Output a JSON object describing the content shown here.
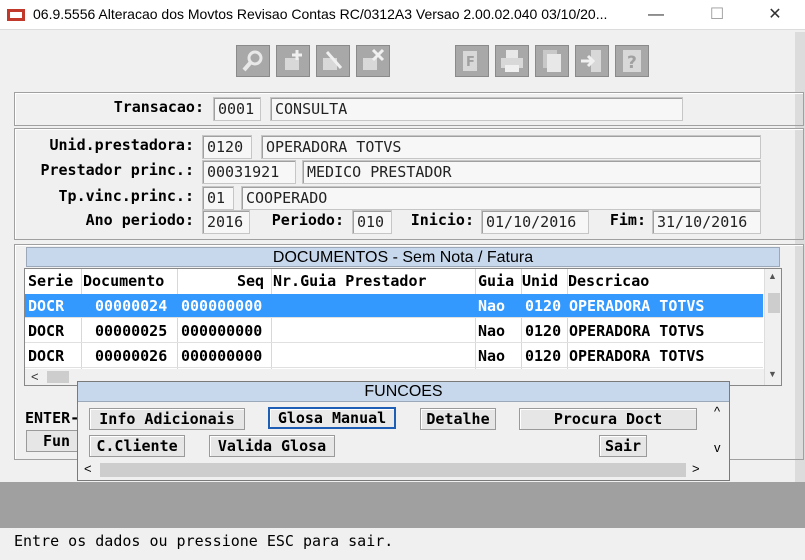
{
  "window": {
    "title": "06.9.5556  Alteracao  dos Movtos Revisao Contas RC/0312A3 Versao 2.00.02.040 03/10/20...",
    "minimize": "—",
    "maximize": "☐",
    "close": "✕"
  },
  "toolbar": {
    "buttons": [
      "search-icon",
      "add-icon",
      "edit-icon",
      "delete-icon",
      "filter-icon",
      "print-icon",
      "copy-icon",
      "exit-icon",
      "help-icon"
    ]
  },
  "transacao": {
    "label": "Transacao:",
    "code": "0001",
    "desc": "CONSULTA"
  },
  "form": {
    "unid_label": "Unid.prestadora:",
    "unid_code": "0120",
    "unid_desc": "OPERADORA TOTVS",
    "prest_label": "Prestador princ.:",
    "prest_code": "00031921",
    "prest_desc": "MEDICO PRESTADOR",
    "tpvinc_label": "Tp.vinc.princ.:",
    "tpvinc_code": "01",
    "tpvinc_desc": "COOPERADO",
    "ano_label": "Ano periodo:",
    "ano_value": "2016",
    "periodo_label": "Periodo:",
    "periodo_value": "010",
    "inicio_label": "Inicio:",
    "inicio_value": "01/10/2016",
    "fim_label": "Fim:",
    "fim_value": "31/10/2016"
  },
  "documents": {
    "title": "DOCUMENTOS - Sem Nota / Fatura",
    "columns": [
      "Serie",
      "Documento",
      "Seq",
      "Nr.Guia Prestador",
      "Guia",
      "Unid",
      "Descricao"
    ],
    "rows": [
      {
        "serie": "DOCR",
        "documento": "00000024",
        "seq": "000000000",
        "nrguia": "",
        "guia": "Nao",
        "unid": "0120",
        "descricao": "OPERADORA TOTVS"
      },
      {
        "serie": "DOCR",
        "documento": "00000025",
        "seq": "000000000",
        "nrguia": "",
        "guia": "Nao",
        "unid": "0120",
        "descricao": "OPERADORA TOTVS"
      },
      {
        "serie": "DOCR",
        "documento": "00000026",
        "seq": "000000000",
        "nrguia": "",
        "guia": "Nao",
        "unid": "0120",
        "descricao": "OPERADORA TOTVS"
      }
    ],
    "scroll_up": "▲",
    "scroll_down": "▼",
    "scroll_left": "<"
  },
  "background": {
    "enter_label": "ENTER-",
    "func_label": "Fun"
  },
  "funcoes": {
    "title": "FUNCOES",
    "info": "Info Adicionais",
    "glosa": "Glosa Manual",
    "detalhe": "Detalhe",
    "procura": "Procura Doct",
    "ccliente": "C.Cliente",
    "valida": "Valida Glosa",
    "sair": "Sair",
    "scroll_up": "^",
    "scroll_down": "v",
    "scroll_left": "<",
    "scroll_right": ">"
  },
  "status": {
    "message": "Entre os dados ou pressione ESC para sair."
  }
}
